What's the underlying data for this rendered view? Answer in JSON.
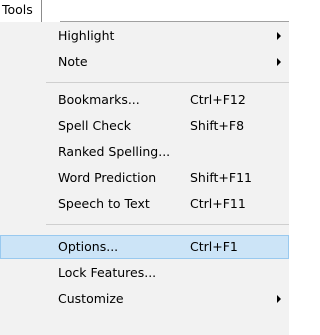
{
  "menubar": {
    "tools_label": "Tools"
  },
  "menu": {
    "group1": [
      {
        "label": "Highlight",
        "submenu": true
      },
      {
        "label": "Note",
        "submenu": true
      }
    ],
    "group2": [
      {
        "label": "Bookmarks...",
        "shortcut": "Ctrl+F12"
      },
      {
        "label": "Spell Check",
        "shortcut": "Shift+F8"
      },
      {
        "label": "Ranked Spelling...",
        "shortcut": ""
      },
      {
        "label": "Word Prediction",
        "shortcut": "Shift+F11"
      },
      {
        "label": "Speech to Text",
        "shortcut": "Ctrl+F11"
      }
    ],
    "group3": [
      {
        "label": "Options...",
        "shortcut": "Ctrl+F1",
        "selected": true
      },
      {
        "label": "Lock Features...",
        "shortcut": ""
      },
      {
        "label": "Customize",
        "submenu": true
      }
    ]
  },
  "colors": {
    "menu_background": "#f2f2f2",
    "selected_fill": "#cce4f7",
    "selected_border": "#99c9ef"
  }
}
